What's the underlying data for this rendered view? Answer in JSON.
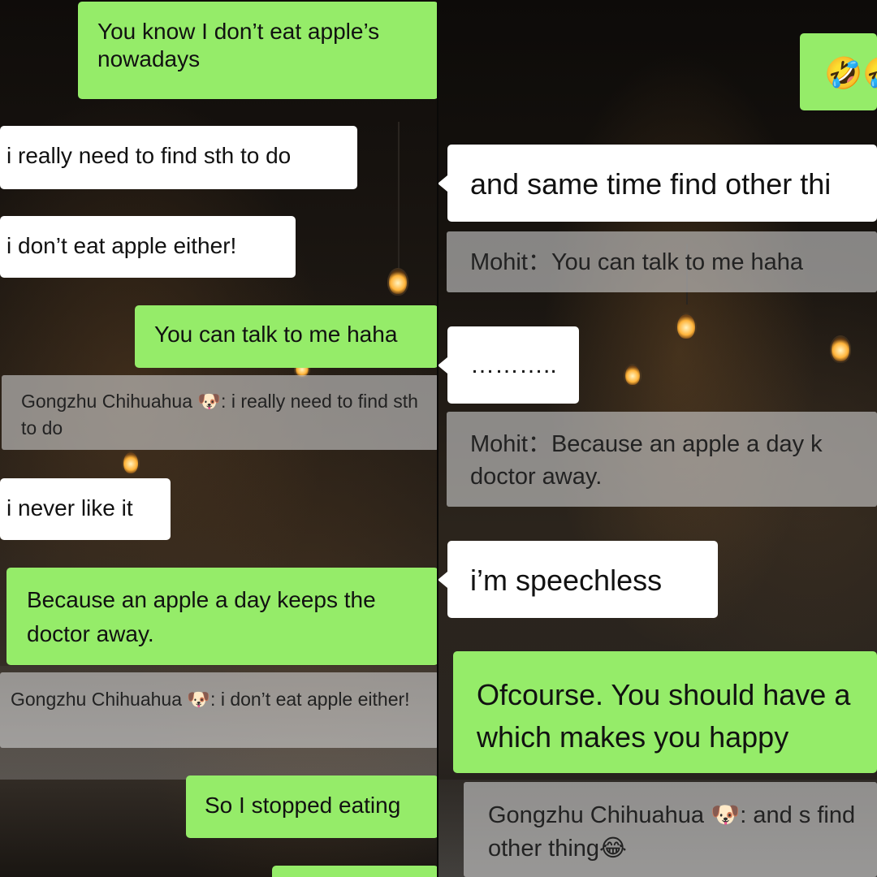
{
  "left_panel": {
    "messages": [
      {
        "text": "You know I don’t eat apple’s nowadays"
      },
      {
        "text": "i really need to find sth to do"
      },
      {
        "text": "i don’t eat apple either!"
      },
      {
        "text": "You can talk to me haha"
      },
      {
        "sender": "Gongzhu Chihuahua",
        "emoji": "🐶",
        "sep": ": ",
        "text": "i really need to find sth to do"
      },
      {
        "text": "i never like it"
      },
      {
        "text": "Because an apple a day keeps the doctor away."
      },
      {
        "sender": "Gongzhu Chihuahua",
        "emoji": "🐶",
        "sep": ": ",
        "text": "i don’t eat apple either!"
      },
      {
        "text": "So I stopped eating"
      }
    ]
  },
  "right_panel": {
    "messages": [
      {
        "text": "🤣🤣"
      },
      {
        "text": "and same time find other thi"
      },
      {
        "sender": "Mohit",
        "sep": "：",
        "text": "You can talk to me haha"
      },
      {
        "text": "……….."
      },
      {
        "sender": "Mohit",
        "sep": "：",
        "text": "Because an apple a day k doctor away."
      },
      {
        "text": "i’m speechless"
      },
      {
        "text": "Ofcourse. You should have a which makes you happy"
      },
      {
        "sender": "Gongzhu Chihuahua",
        "emoji": "🐶",
        "sep": ": ",
        "text": "and s find other thing",
        "trailing_emoji": "😂"
      }
    ]
  },
  "colors": {
    "sent_bubble": "#95ec69",
    "received_bubble": "#ffffff",
    "quote_bubble": "#cdcdcd"
  }
}
